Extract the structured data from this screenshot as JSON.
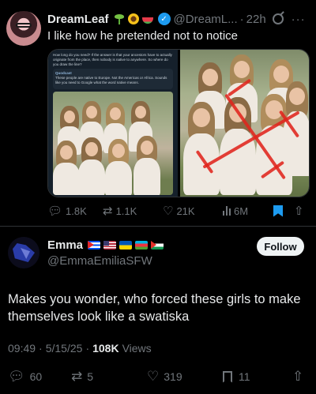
{
  "top_tweet": {
    "author_name": "DreamLeaf",
    "handle": "@DreamL...",
    "time": "22h",
    "text": "I like how he pretended not to notice",
    "screenshot_text": "How long do you need? If the answer is that your ancestors have to actually originate from the place, then nobody is native to anywhere. So where do you draw the line?",
    "screenshot_card_author": "Quodcast",
    "screenshot_card_text": "These people are native to Europe. Not the Americas or Africa. Sounds like you need to Google what the word native means.",
    "stats": {
      "replies": "1.8K",
      "reposts": "1.1K",
      "likes": "21K",
      "views": "6M"
    }
  },
  "main_tweet": {
    "author_name": "Emma",
    "handle": "@EmmaEmiliaSFW",
    "follow_label": "Follow",
    "text": "Makes you wonder, who forced these girls to make themselves look like a swatiska",
    "time": "09:49",
    "date": "5/15/25",
    "views_count": "108K",
    "views_label": "Views",
    "stats": {
      "replies": "60",
      "reposts": "5",
      "likes": "319",
      "bookmarks": "11"
    }
  },
  "colors": {
    "background": "#000000",
    "text": "#e7e9ea",
    "muted": "#71767b",
    "accent": "#1d9bf0",
    "divider": "#2f3336"
  },
  "icons": [
    "verified-badge-icon",
    "grok-icon",
    "more-icon",
    "reply-icon",
    "repost-icon",
    "like-icon",
    "views-icon",
    "bookmark-icon",
    "share-icon"
  ]
}
